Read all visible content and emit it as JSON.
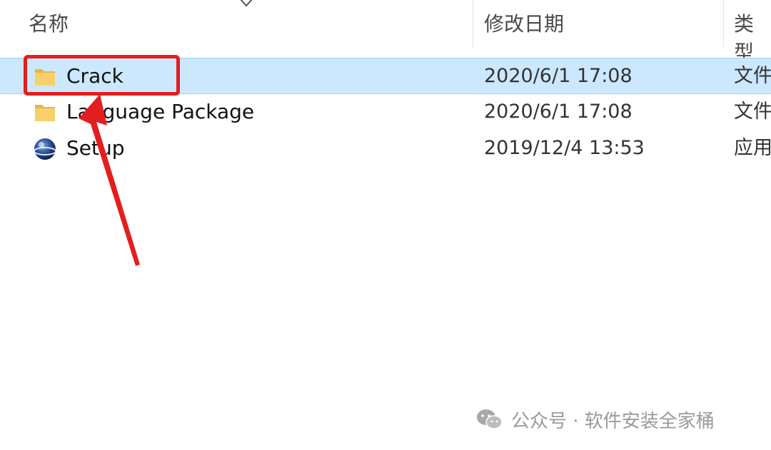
{
  "columns": {
    "name": "名称",
    "date": "修改日期",
    "type": "类型"
  },
  "files": [
    {
      "name": "Crack",
      "date": "2020/6/1 17:08",
      "type": "文件",
      "icon": "folder-icon",
      "selected": true
    },
    {
      "name": "Language Package",
      "date": "2020/6/1 17:08",
      "type": "文件",
      "icon": "folder-icon",
      "selected": false
    },
    {
      "name": "Setup",
      "date": "2019/12/4 13:53",
      "type": "应用",
      "icon": "setup-app-icon",
      "selected": false
    }
  ],
  "watermark": {
    "text": "公众号 · 软件安装全家桶",
    "icon": "wechat-icon"
  },
  "colors": {
    "selection": "#cce8ff",
    "annotation": "#e41e1e",
    "folder": "#f7d06b"
  }
}
